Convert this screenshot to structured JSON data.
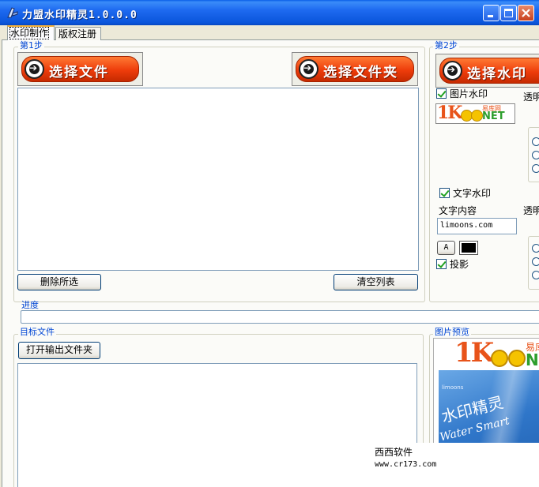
{
  "window": {
    "title": "力盟水印精灵1.0.0.0"
  },
  "tabs": [
    {
      "label": "水印制作"
    },
    {
      "label": "版权注册"
    }
  ],
  "step1": {
    "label": "第1步",
    "select_file": "选择文件",
    "select_folder": "选择文件夹",
    "delete_selected": "删除所选",
    "clear_list": "清空列表"
  },
  "step2": {
    "label": "第2步",
    "select_watermark": "选择水印",
    "image_watermark": {
      "label": "图片水印",
      "checked": true
    },
    "transparency_label_1": "透明",
    "text_watermark": {
      "label": "文字水印",
      "checked": true
    },
    "text_content_label": "文字内容",
    "transparency_label_2": "透明",
    "text_content_value": "limoons.com",
    "font_button": "A",
    "text_color": "#000000",
    "shadow": {
      "label": "投影",
      "checked": true
    },
    "logo": {
      "brand_1k": "1K",
      "net": "NET",
      "small_text": "易库网"
    }
  },
  "progress": {
    "label": "进度",
    "value": 0
  },
  "target": {
    "label": "目标文件",
    "open_output_folder": "打开输出文件夹"
  },
  "preview": {
    "label": "图片预览",
    "logo": {
      "brand_1k": "1K",
      "net": "NET",
      "small_text": "易库"
    },
    "box_brand": "limoons",
    "box_title": "水印精灵",
    "box_subtitle": "Water Smart"
  },
  "watermark_overlay": {
    "line1": "西西软件",
    "line2": "www.cr173.com"
  },
  "colors": {
    "title_bar": "#0a55db",
    "group_label": "#0046d5",
    "button_orange": "#ee3c0b"
  }
}
